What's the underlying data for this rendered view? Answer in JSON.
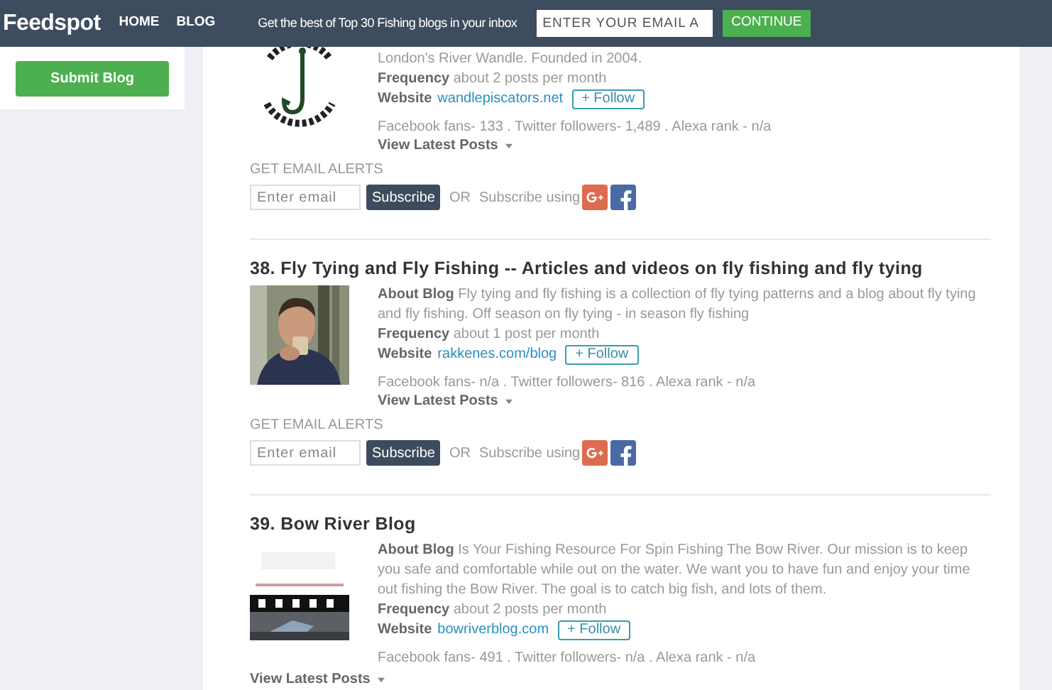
{
  "header": {
    "logo": "Feedspot",
    "nav": [
      "HOME",
      "BLOG"
    ],
    "promo": "Get the best of Top 30 Fishing blogs in your inbox",
    "email_placeholder": "ENTER YOUR EMAIL A",
    "continue": "CONTINUE"
  },
  "sidebar": {
    "submit": "Submit Blog"
  },
  "blogs": [
    {
      "kind": "inline",
      "about": "London's River Wandle. Founded in 2004.",
      "frequency": "**Frequency** about 2 posts per month",
      "website_label": "Website",
      "website": "wandlepiscators.net",
      "follow": "+ Follow",
      "stats": "Facebook fans- 133 . Twitter followers- 1,489 . Alexa rank - n/a",
      "view_latest": "View Latest Posts",
      "alerts": {
        "heading": "GET EMAIL ALERTS",
        "placeholder": "Enter email",
        "subscribe": "Subscribe",
        "or": "OR",
        "subscribe_using": "Subscribe using"
      }
    },
    {
      "kind": "inline",
      "title": "38. Fly Tying and Fly Fishing -- Articles and videos on fly fishing and fly tying",
      "about": "**About Blog** Fly tying and fly fishing is a collection of fly tying patterns and a blog about fly tying and fly fishing. Off season on fly tying - in season fly fishing",
      "frequency": "**Frequency** about 1 post per month",
      "website_label": "Website",
      "website": "rakkenes.com/blog",
      "follow": "+ Follow",
      "stats": "Facebook fans- n/a . Twitter followers- 816 . Alexa rank - n/a",
      "view_latest": "View Latest Posts",
      "alerts": {
        "heading": "GET EMAIL ALERTS",
        "placeholder": "Enter email",
        "subscribe": "Subscribe",
        "or": "OR",
        "subscribe_using": "Subscribe using"
      }
    },
    {
      "kind": "below",
      "title": "39. Bow River Blog",
      "about": "**About Blog** Is Your Fishing Resource For Spin Fishing The Bow River. Our mission is to keep you safe and comfortable while out on the water. We want you to have fun and enjoy your time out fishing the Bow River. The goal is to catch big fish, and lots of them.",
      "frequency": "**Frequency** about 2 posts per month",
      "website_label": "Website",
      "website": "bowriverblog.com",
      "follow": "+ Follow",
      "stats": "Facebook fans- 491 . Twitter followers- n/a . Alexa rank - n/a",
      "view_latest": "View Latest Posts"
    }
  ]
}
